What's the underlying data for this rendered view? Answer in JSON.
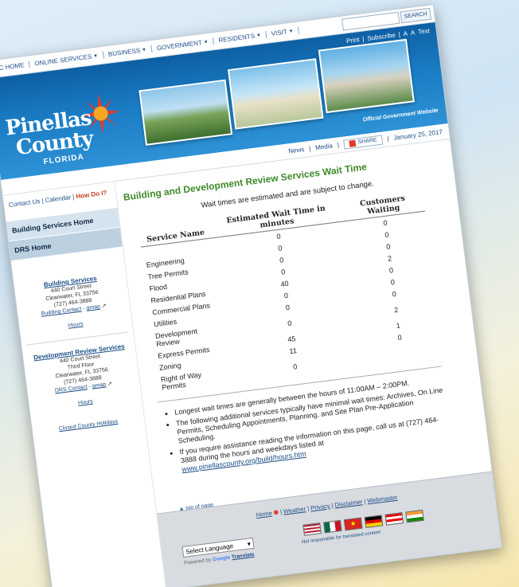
{
  "colors": {
    "banner_blue": "#1a7cc4",
    "heading_green": "#3f8a2a",
    "link_blue": "#1c4d86",
    "how_do_i_red": "#c63a1f"
  },
  "topnav": {
    "items": [
      {
        "label": "PC HOME",
        "has_menu": false
      },
      {
        "label": "ONLINE SERVICES",
        "has_menu": true
      },
      {
        "label": "BUSINESS",
        "has_menu": true
      },
      {
        "label": "GOVERNMENT",
        "has_menu": true
      },
      {
        "label": "RESIDENTS",
        "has_menu": true
      },
      {
        "label": "VISIT",
        "has_menu": true
      }
    ],
    "search_placeholder": "",
    "search_button": "SEARCH"
  },
  "banner": {
    "links": [
      "Print",
      "Subscribe",
      "A",
      "A",
      "Text"
    ],
    "logo_line1": "Pinellas",
    "logo_line2": "County",
    "logo_line3": "FLORIDA",
    "official": "Official Government Website"
  },
  "subbar": {
    "news": "News",
    "media": "Media",
    "share": "SHARE",
    "date": "January 25, 2017"
  },
  "sidebar": {
    "contact": "Contact Us",
    "calendar": "Calendar",
    "how_do_i": "How Do I?",
    "nav": [
      "Building Services Home",
      "DRS Home"
    ],
    "building": {
      "title": "Building Services",
      "lines": [
        "440 Court Street",
        "Clearwater, FL 33756",
        "(727) 464-3888"
      ],
      "contact_link": "Building Contact",
      "gmap": "gmap",
      "hours": "Hours"
    },
    "drs": {
      "title": "Development Review Services",
      "lines": [
        "440 Court Street",
        "Third Floor",
        "Clearwater, FL 33756",
        "(727) 464-3888"
      ],
      "contact_link": "DRS Contact",
      "gmap": "gmap",
      "hours": "Hours"
    },
    "holidays": "Closed County Holidays"
  },
  "main": {
    "title": "Building and Development Review Services Wait Time",
    "intro": "Wait times are estimated and are subject to change.",
    "table": {
      "headers": [
        "Service Name",
        "Estimated Wait Time in minutes",
        "Customers Waiting"
      ],
      "rows": [
        {
          "name": "",
          "wait": "0",
          "customers": "0"
        },
        {
          "name": "Engineering",
          "wait": "0",
          "customers": "0"
        },
        {
          "name": "Tree Permits",
          "wait": "0",
          "customers": "0"
        },
        {
          "name": "Flood",
          "wait": "0",
          "customers": "2"
        },
        {
          "name": "Residential Plans",
          "wait": "40",
          "customers": "0"
        },
        {
          "name": "Commercial Plans",
          "wait": "0",
          "customers": "0"
        },
        {
          "name": "Utilities",
          "wait": "0",
          "customers": "0"
        },
        {
          "name": "Development Review",
          "wait": "0",
          "customers": "2"
        },
        {
          "name": "Express Permits",
          "wait": "45",
          "customers": "1"
        },
        {
          "name": "Zoning",
          "wait": "11",
          "customers": "0"
        },
        {
          "name": "Right of Way Permits",
          "wait": "0",
          "customers": ""
        }
      ]
    },
    "notes": [
      "Longest wait times are generally between the hours of 11:00AM – 2:00PM.",
      "The following additional services typically have minimal wait times: Archives, On Line Permits, Scheduling Appointments, Planning, and Site Plan Pre-Application Scheduling.",
      "If you require assistance reading the information on this page, call us at (727) 464-3888 during the hours and weekdays listed at"
    ],
    "hours_url": "www.pinellascounty.org/build/hours.htm",
    "top_of_page": "top of page"
  },
  "footer": {
    "links": [
      "Home",
      "Weather",
      "Privacy",
      "Disclaimer",
      "Webmaster"
    ],
    "language_select": "Select Language",
    "powered_by": "Powered by",
    "google": "Google",
    "translate": "Translate",
    "not_responsible": "Not responsible for translated content"
  }
}
